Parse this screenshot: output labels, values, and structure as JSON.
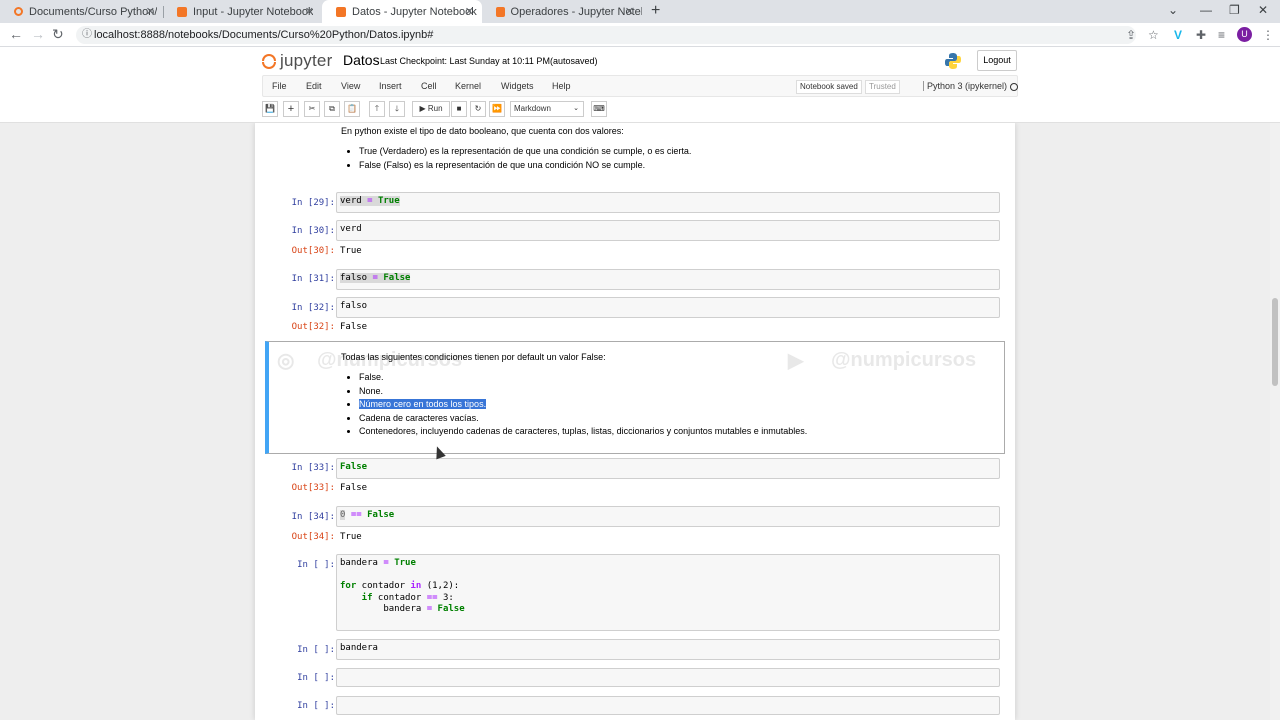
{
  "browser": {
    "tabs": [
      {
        "title": "Documents/Curso Python/",
        "active": false
      },
      {
        "title": "Input - Jupyter Notebook",
        "active": false
      },
      {
        "title": "Datos - Jupyter Notebook",
        "active": true
      },
      {
        "title": "Operadores - Jupyter Notebook",
        "active": false
      }
    ],
    "url": "localhost:8888/notebooks/Documents/Curso%20Python/Datos.ipynb#",
    "avatar_letter": "U"
  },
  "jupyter": {
    "logo_text": "jupyter",
    "notebook_name": "Datos",
    "checkpoint": "Last Checkpoint: Last Sunday at 10:11 PM",
    "autosaved": "(autosaved)",
    "logout_label": "Logout",
    "menu": [
      "File",
      "Edit",
      "View",
      "Insert",
      "Cell",
      "Kernel",
      "Widgets",
      "Help"
    ],
    "notebook_saved": "Notebook saved",
    "trusted": "Trusted",
    "kernel_name": "Python 3 (ipykernel)",
    "run_label": "Run",
    "cell_type": "Markdown"
  },
  "cells": {
    "md1": {
      "intro": "En python existe el tipo de dato booleano, que cuenta con dos valores:",
      "items": [
        "True (Verdadero) es la representación de que una condición se cumple, o es cierta.",
        "False (Falso) es la representación de que una condición NO se cumple."
      ]
    },
    "c29": {
      "prompt": "In [29]:",
      "code_a": "verd",
      "code_op": " = ",
      "code_b": "True"
    },
    "c30": {
      "prompt": "In [30]:",
      "code": "verd",
      "out_prompt": "Out[30]:",
      "out": "True"
    },
    "c31": {
      "prompt": "In [31]:",
      "code_a": "falso",
      "code_op": " = ",
      "code_b": "False"
    },
    "c32": {
      "prompt": "In [32]:",
      "code": "falso",
      "out_prompt": "Out[32]:",
      "out": "False"
    },
    "md2": {
      "intro": "Todas las siguientes condiciones tienen por default un valor False:",
      "items": [
        "False.",
        "None.",
        "Número cero en todos los tipos.",
        "Cadena de caracteres vacías.",
        "Contenedores, incluyendo cadenas de caracteres, tuplas, listas, diccionarios y conjuntos mutables e inmutables."
      ],
      "watermark_left": "@numpicursos",
      "watermark_right": "@numpicursos"
    },
    "c33": {
      "prompt": "In [33]:",
      "code": "False",
      "out_prompt": "Out[33]:",
      "out": "False"
    },
    "c34": {
      "prompt": "In [34]:",
      "code_a": "0",
      "code_op": " == ",
      "code_b": "False",
      "out_prompt": "Out[34]:",
      "out": "True"
    },
    "c35": {
      "prompt": "In [ ]:",
      "l1a": "bandera",
      "l1op": " = ",
      "l1b": "True",
      "l2a": "for",
      "l2b": " contador ",
      "l2c": "in",
      "l2d": " (1,2):",
      "l3a": "    if",
      "l3b": " contador ",
      "l3c": "==",
      "l3d": " 3:",
      "l4a": "        bandera ",
      "l4op": "=",
      "l4b": " False"
    },
    "c36": {
      "prompt": "In [ ]:",
      "code": "bandera"
    },
    "c37": {
      "prompt": "In [ ]:"
    },
    "c38": {
      "prompt": "In [ ]:"
    }
  }
}
